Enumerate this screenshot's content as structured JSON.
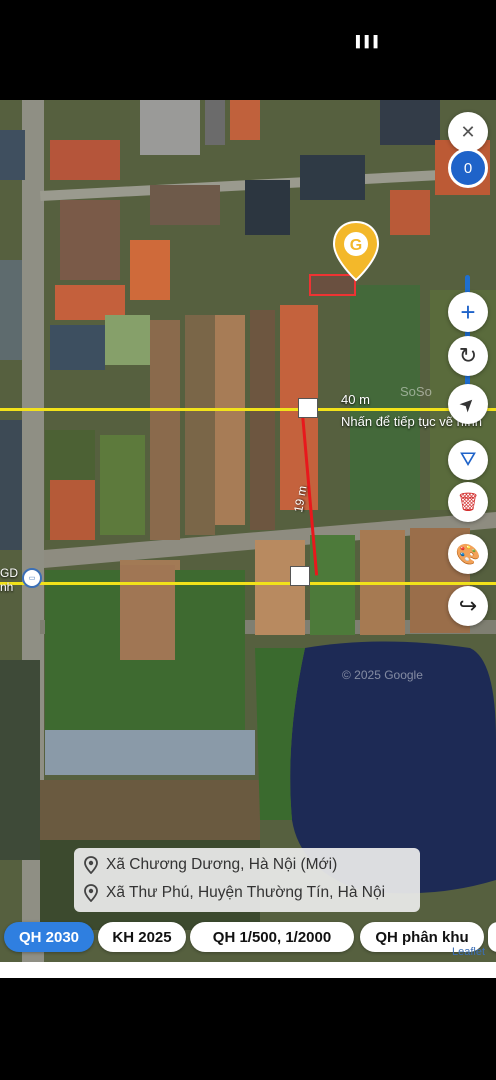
{
  "status_bar": {
    "indicator": "▐▐▐"
  },
  "map": {
    "zoom_level": "0",
    "measure_distance": "40 m",
    "measure_hint": "Nhấn để tiếp tục vẽ hình",
    "segment_length": "19 m",
    "poi_label_top": "GD",
    "poi_label_bottom": "nh",
    "copyright": "© 2025 Google",
    "watermark": "SoSo",
    "attribution": "Leaflet"
  },
  "controls": [
    {
      "name": "close-icon",
      "glyph": "✕"
    },
    {
      "name": "zoom-in-icon",
      "glyph": "+"
    },
    {
      "name": "refresh-icon",
      "glyph": "↻"
    },
    {
      "name": "locate-icon",
      "glyph": "➤"
    },
    {
      "name": "measure-tool-icon",
      "glyph": "⛛"
    },
    {
      "name": "trash-icon",
      "glyph": "🗑"
    },
    {
      "name": "palette-icon",
      "glyph": "🎨"
    },
    {
      "name": "share-icon",
      "glyph": "↪"
    }
  ],
  "location": {
    "line1": "Xã Chương Dương, Hà Nội (Mới)",
    "line2": "Xã Thư Phú, Huyện Thường Tín, Hà Nội"
  },
  "chips": [
    {
      "label": "QH 2030",
      "active": true
    },
    {
      "label": "KH 2025",
      "active": false
    },
    {
      "label": "QH 1/500, 1/2000",
      "active": false
    },
    {
      "label": "QH phân khu",
      "active": false
    }
  ],
  "colors": {
    "accent": "#2f7fe0",
    "measure_line": "#f2e21a",
    "segment_line": "#e8181c",
    "pin": "#f3b82a"
  }
}
